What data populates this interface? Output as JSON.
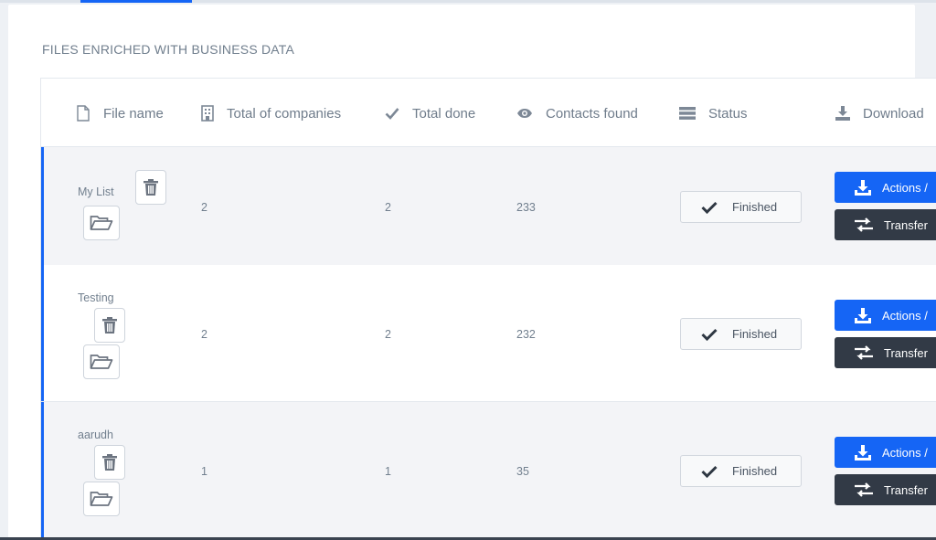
{
  "section_title": "Files enriched with business data",
  "table": {
    "columns": [
      {
        "label": "File name",
        "icon": "file-icon"
      },
      {
        "label": "Total of companies",
        "icon": "building-icon"
      },
      {
        "label": "Total done",
        "icon": "check-icon"
      },
      {
        "label": "Contacts found",
        "icon": "eye-icon"
      },
      {
        "label": "Status",
        "icon": "server-icon"
      },
      {
        "label": "Download",
        "icon": "download-icon"
      }
    ],
    "rows": [
      {
        "file_name": "My List",
        "total_companies": "2",
        "total_done": "2",
        "contacts_found": "233",
        "status": "Finished",
        "actions_label": "Actions /",
        "transfer_label": "Transfer"
      },
      {
        "file_name": "Testing",
        "total_companies": "2",
        "total_done": "2",
        "contacts_found": "232",
        "status": "Finished",
        "actions_label": "Actions /",
        "transfer_label": "Transfer"
      },
      {
        "file_name": "aarudh",
        "total_companies": "1",
        "total_done": "1",
        "contacts_found": "35",
        "status": "Finished",
        "actions_label": "Actions /",
        "transfer_label": "Transfer"
      }
    ]
  },
  "colors": {
    "accent": "#1565f5",
    "dark_button": "#323a46",
    "text_muted": "#717f8e"
  }
}
